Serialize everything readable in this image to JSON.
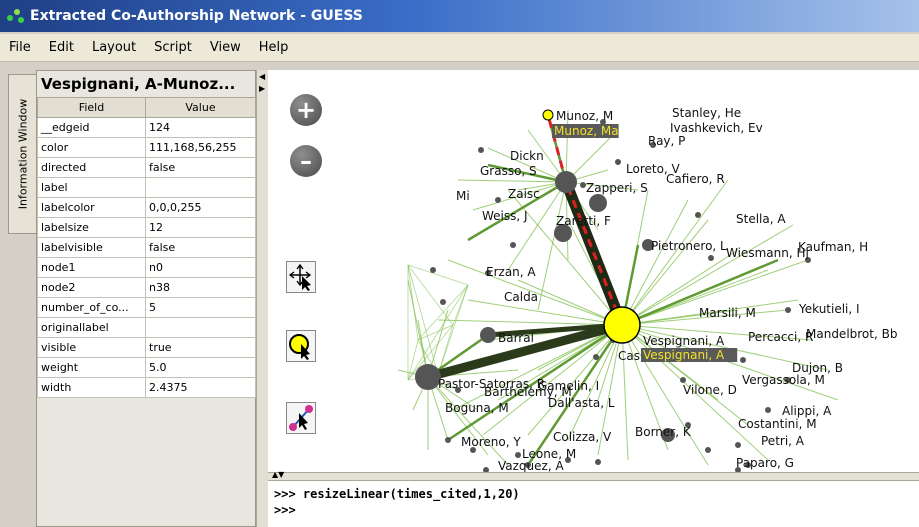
{
  "window": {
    "title": "Extracted Co-Authorship Network - GUESS"
  },
  "menu": [
    "File",
    "Edit",
    "Layout",
    "Script",
    "View",
    "Help"
  ],
  "side_tab": {
    "label": "Information Window"
  },
  "info_panel": {
    "title": "Vespignani, A-Munoz...",
    "columns": [
      "Field",
      "Value"
    ],
    "rows": [
      [
        "__edgeid",
        "124"
      ],
      [
        "color",
        "111,168,56,255"
      ],
      [
        "directed",
        "false"
      ],
      [
        "label",
        ""
      ],
      [
        "labelcolor",
        "0,0,0,255"
      ],
      [
        "labelsize",
        "12"
      ],
      [
        "labelvisible",
        "false"
      ],
      [
        "node1",
        "n0"
      ],
      [
        "node2",
        "n38"
      ],
      [
        "number_of_co...",
        "5"
      ],
      [
        "originallabel",
        ""
      ],
      [
        "visible",
        "true"
      ],
      [
        "weight",
        "5.0"
      ],
      [
        "width",
        "2.4375"
      ]
    ]
  },
  "tools": {
    "zoom_in": "+",
    "zoom_out": "–",
    "icons": [
      "pan-move-icon",
      "select-node-icon",
      "connect-nodes-icon"
    ]
  },
  "graph": {
    "colors": {
      "edge": "#7fbf4d",
      "strong_edge": "#1f2a14",
      "highlight": "#ffff00",
      "dashed": "#e02020",
      "node": "#555555"
    },
    "labels": [
      "Munoz, M",
      "Stanley, He",
      "Ivashkevich, Ev",
      "Ray, P",
      "Dickn",
      "Loreto, V",
      "Grasso, S",
      "Cafiero, R",
      "Mi",
      "Zaisc",
      "Zapperi, S",
      "Weiss, J",
      "Zaretti, F",
      "Stella, A",
      "Pietronero, L",
      "Wiesmann, Hj",
      "Kaufman, H",
      "Erzan, A",
      "Calda",
      "Marsili, M",
      "Yekutieli, I",
      "Barral",
      "Percacci, R",
      "Mandelbrot, Bb",
      "Vespignani, A",
      "Cas",
      "Dujon, B",
      "Pastor-Satorras, R",
      "Barthelemy, M",
      "Gamelin, I",
      "Vergassola, M",
      "Vilone, D",
      "Dall'asta, L",
      "Boguna, M",
      "Alippi, A",
      "Costantini, M",
      "Moreno, Y",
      "Colizza, V",
      "Borner, K",
      "Leone, M",
      "Petri, A",
      "Vazquez, A",
      "Paparo, G"
    ],
    "highlighted_labels": [
      "Munoz, Ma",
      "Vespignani, A"
    ]
  },
  "console": {
    "lines": [
      ">>> resizeLinear(times_cited,1,20)",
      ">>>"
    ]
  }
}
